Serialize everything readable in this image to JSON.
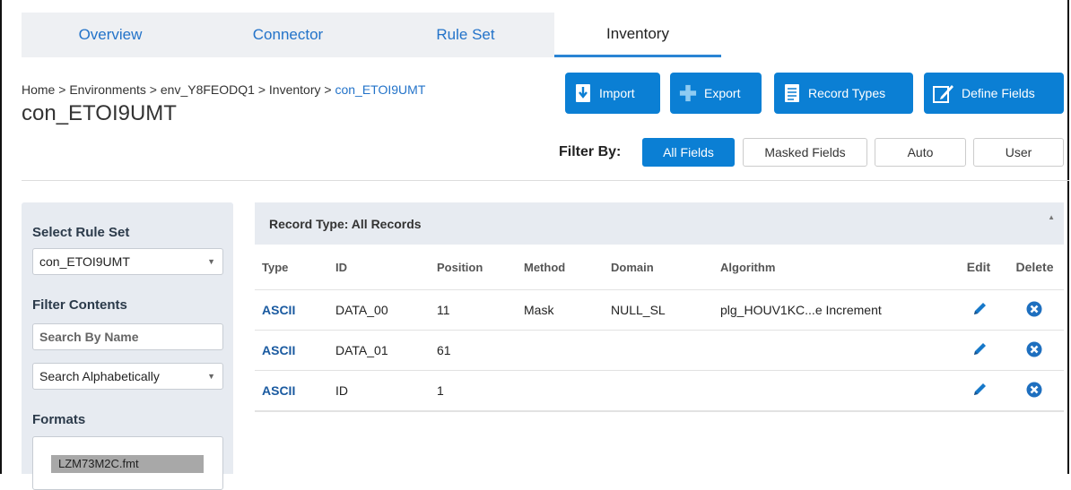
{
  "tabs": [
    {
      "label": "Overview",
      "active": false
    },
    {
      "label": "Connector",
      "active": false
    },
    {
      "label": "Rule Set",
      "active": false
    },
    {
      "label": "Inventory",
      "active": true
    }
  ],
  "breadcrumb": {
    "home": "Home",
    "environments": "Environments",
    "env": "env_Y8FEODQ1",
    "inventory": "Inventory",
    "current": "con_ETOI9UMT",
    "separator": " > "
  },
  "page_title": "con_ETOI9UMT",
  "actions": {
    "import": "Import",
    "export": "Export",
    "record_types": "Record Types",
    "define_fields": "Define Fields"
  },
  "filter": {
    "label": "Filter By:",
    "options": [
      "All Fields",
      "Masked Fields",
      "Auto",
      "User"
    ],
    "selected": "All Fields"
  },
  "sidebar": {
    "select_rule_set_label": "Select Rule Set",
    "rule_set_value": "con_ETOI9UMT",
    "filter_contents_label": "Filter Contents",
    "search_placeholder": "Search By Name",
    "sort_value": "Search Alphabetically",
    "formats_label": "Formats",
    "formats": [
      "LZM73M2C.fmt"
    ]
  },
  "table": {
    "record_type_label": "Record Type: All Records",
    "columns": [
      "Type",
      "ID",
      "Position",
      "Method",
      "Domain",
      "Algorithm",
      "Edit",
      "Delete"
    ],
    "rows": [
      {
        "type": "ASCII",
        "id": "DATA_00",
        "position": "11",
        "method": "Mask",
        "domain": "NULL_SL",
        "algorithm": "plg_HOUV1KC...e Increment"
      },
      {
        "type": "ASCII",
        "id": "DATA_01",
        "position": "61",
        "method": "",
        "domain": "",
        "algorithm": ""
      },
      {
        "type": "ASCII",
        "id": "ID",
        "position": "1",
        "method": "",
        "domain": "",
        "algorithm": ""
      }
    ]
  },
  "colors": {
    "accent": "#0b7fd4",
    "link": "#2373c9",
    "panel": "#e7ebf1"
  },
  "icons": {
    "import": "import-icon",
    "export": "export-icon",
    "record_types": "document-list-icon",
    "define_fields": "edit-form-icon",
    "edit": "pencil-icon",
    "delete": "close-circle-icon"
  }
}
